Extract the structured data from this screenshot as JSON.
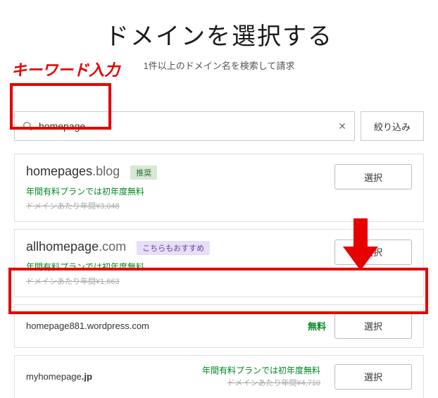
{
  "header": {
    "title": "ドメインを選択する",
    "subtitle": "1件以上のドメイン名を検索して請求"
  },
  "search": {
    "value": "homepage",
    "filter_label": "絞り込み"
  },
  "domains": [
    {
      "name": "homepages",
      "tld": ".blog",
      "badge": "推奨",
      "promo": "年間有料プランでは初年度無料",
      "strike": "ドメインあたり年間¥3,048",
      "select_label": "選択"
    },
    {
      "name": "allhomepage",
      "tld": ".com",
      "badge": "こちらもおすすめ",
      "promo": "年間有料プランでは初年度無料",
      "strike": "ドメインあたり年間¥1,663",
      "select_label": "選択"
    },
    {
      "name_full": "homepage881.wordpress.com",
      "price_label": "無料",
      "select_label": "選択"
    },
    {
      "name": "myhomepage",
      "tld": ".jp",
      "promo": "年間有料プランでは初年度無料",
      "strike": "ドメインあたり年間¥4,710",
      "select_label": "選択"
    }
  ],
  "annotations": {
    "keyword_label": "キーワード入力",
    "box_color": "#e60000"
  }
}
